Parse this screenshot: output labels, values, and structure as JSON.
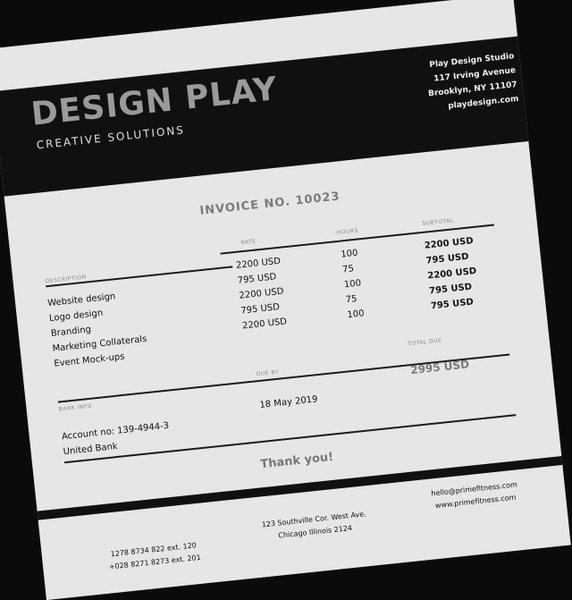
{
  "company": {
    "name": "DESIGN PLAY",
    "tagline": "CREATIVE SOLUTIONS",
    "address": [
      "Play Design Studio",
      "117 Irving Avenue",
      "Brooklyn, NY 11107",
      "playdesign.com"
    ]
  },
  "invoice": {
    "title": "INVOICE NO. 10023",
    "headers": {
      "description": "DESCRIPTION",
      "rate": "RATE",
      "hours": "HOURS",
      "subtotal": "SUBTOTAL"
    },
    "items": [
      {
        "description": "Website design",
        "rate": "2200 USD",
        "hours": "100",
        "subtotal": "2200 USD"
      },
      {
        "description": "Logo design",
        "rate": "795 USD",
        "hours": "75",
        "subtotal": "795 USD"
      },
      {
        "description": "Branding",
        "rate": "2200 USD",
        "hours": "100",
        "subtotal": "2200 USD"
      },
      {
        "description": "Marketing Collaterals",
        "rate": "795 USD",
        "hours": "75",
        "subtotal": "795 USD"
      },
      {
        "description": "Event Mock-ups",
        "rate": "2200 USD",
        "hours": "100",
        "subtotal": "795 USD"
      }
    ],
    "bank_info_label": "BANK INFO",
    "due_by_label": "DUE BY",
    "total_due_label": "TOTAL DUE",
    "account": "Account no: 139-4944-3",
    "bank": "United Bank",
    "due_date": "18 May 2019",
    "total": "2995 USD",
    "thanks": "Thank you!"
  },
  "footer": {
    "phones": [
      "1278 8734 822 ext. 120",
      "+028 8271 8273 ext. 201"
    ],
    "address": [
      "123 Southville Cor. West Ave.",
      "Chicago Illinois 2124"
    ],
    "web": [
      "hello@primefitness.com",
      "www.primefitness.com"
    ]
  }
}
